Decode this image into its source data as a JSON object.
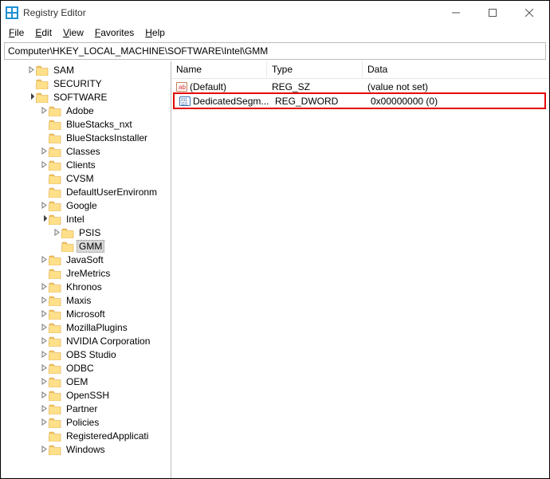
{
  "window": {
    "title": "Registry Editor"
  },
  "menu": {
    "file": "File",
    "edit": "Edit",
    "view": "View",
    "favorites": "Favorites",
    "help": "Help"
  },
  "address": "Computer\\HKEY_LOCAL_MACHINE\\SOFTWARE\\Intel\\GMM",
  "columns": {
    "name": "Name",
    "type": "Type",
    "data": "Data"
  },
  "values": [
    {
      "icon": "string",
      "name": "(Default)",
      "type": "REG_SZ",
      "data": "(value not set)"
    },
    {
      "icon": "binary",
      "name": "DedicatedSegm...",
      "type": "REG_DWORD",
      "data": "0x00000000 (0)"
    }
  ],
  "tree": {
    "sam": "SAM",
    "security": "SECURITY",
    "software": "SOFTWARE",
    "children": {
      "adobe": "Adobe",
      "bluestacks_nxt": "BlueStacks_nxt",
      "bluestacksinstaller": "BlueStacksInstaller",
      "classes": "Classes",
      "clients": "Clients",
      "cvsm": "CVSM",
      "defaultuserenv": "DefaultUserEnvironment",
      "google": "Google",
      "intel": "Intel",
      "intel_children": {
        "psis": "PSIS",
        "gmm": "GMM"
      },
      "javasoft": "JavaSoft",
      "jremetrics": "JreMetrics",
      "khronos": "Khronos",
      "maxis": "Maxis",
      "microsoft": "Microsoft",
      "mozillaplugins": "MozillaPlugins",
      "nvidia": "NVIDIA Corporation",
      "obs": "OBS Studio",
      "odbc": "ODBC",
      "oem": "OEM",
      "openssh": "OpenSSH",
      "partner": "Partner",
      "policies": "Policies",
      "registeredapp": "RegisteredApplications",
      "windows": "Windows"
    }
  }
}
